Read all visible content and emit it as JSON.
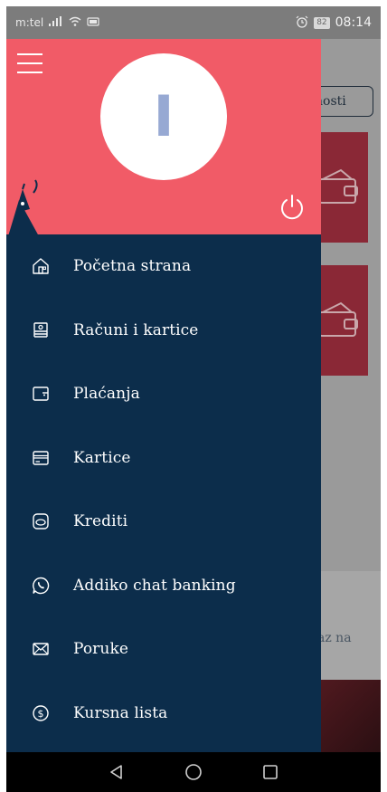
{
  "status_bar": {
    "carrier": "m:tel",
    "battery": "82",
    "time": "08:14"
  },
  "background": {
    "pill_text": "nosti",
    "partial_text": "az na"
  },
  "drawer": {
    "avatar_initial": "I",
    "accent_color": "#f15b67",
    "menu_bg_color": "#0c2d4b",
    "menu": [
      {
        "label": "Početna strana",
        "icon": "home-icon"
      },
      {
        "label": "Računi i kartice",
        "icon": "accounts-icon"
      },
      {
        "label": "Plaćanja",
        "icon": "wallet-icon"
      },
      {
        "label": "Kartice",
        "icon": "card-icon"
      },
      {
        "label": "Krediti",
        "icon": "loan-icon"
      },
      {
        "label": "Addiko chat banking",
        "icon": "chat-phone-icon"
      },
      {
        "label": "Poruke",
        "icon": "envelope-icon"
      },
      {
        "label": "Kursna lista",
        "icon": "dollar-icon"
      }
    ]
  }
}
